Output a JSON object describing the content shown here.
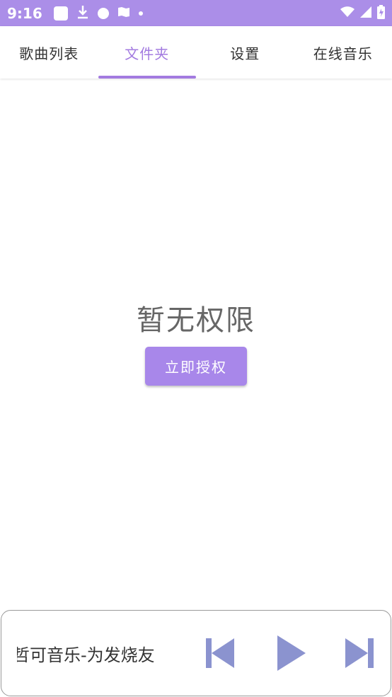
{
  "status_bar": {
    "time": "9:16"
  },
  "tabs": [
    {
      "label": "歌曲列表",
      "active": false
    },
    {
      "label": "文件夹",
      "active": true
    },
    {
      "label": "设置",
      "active": false
    },
    {
      "label": "在线音乐",
      "active": false
    }
  ],
  "empty_state": {
    "title": "暂无权限",
    "button_label": "立即授权"
  },
  "player": {
    "track_title": "哲可音乐-为发烧友"
  },
  "colors": {
    "status_bar": "#ab8ee8",
    "accent": "#a37be0",
    "button": "#a887ea",
    "controls": "#8b93cf"
  }
}
